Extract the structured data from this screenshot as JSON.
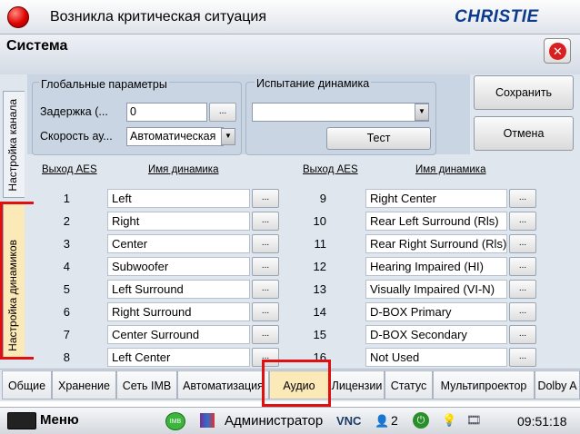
{
  "window": {
    "title": "Возникла критическая ситуация",
    "logo": "CHRISTIE"
  },
  "section": {
    "title": "Система",
    "close_icon": "close-icon"
  },
  "side_tabs": [
    "Настройка канала",
    "Настройка динамиков"
  ],
  "global_params": {
    "label": "Глобальные параметры",
    "delay_label": "Задержка (...",
    "delay_value": "0",
    "speed_label": "Скорость ау...",
    "speed_value": "Автоматическая",
    "more": "..."
  },
  "speaker_test": {
    "label": "Испытание динамика",
    "select_value": "",
    "test_button": "Тест"
  },
  "actions": {
    "save": "Сохранить",
    "cancel": "Отмена"
  },
  "table": {
    "headers": {
      "aes": "Выход AES",
      "name": "Имя динамика"
    },
    "left": [
      {
        "n": "1",
        "name": "Left"
      },
      {
        "n": "2",
        "name": "Right"
      },
      {
        "n": "3",
        "name": "Center"
      },
      {
        "n": "4",
        "name": "Subwoofer"
      },
      {
        "n": "5",
        "name": "Left Surround"
      },
      {
        "n": "6",
        "name": "Right Surround"
      },
      {
        "n": "7",
        "name": "Center Surround"
      },
      {
        "n": "8",
        "name": "Left Center"
      }
    ],
    "right": [
      {
        "n": "9",
        "name": "Right Center"
      },
      {
        "n": "10",
        "name": "Rear Left Surround (Rls)"
      },
      {
        "n": "11",
        "name": "Rear Right Surround (Rls)"
      },
      {
        "n": "12",
        "name": "Hearing Impaired (HI)"
      },
      {
        "n": "13",
        "name": "Visually Impaired (VI-N)"
      },
      {
        "n": "14",
        "name": "D-BOX Primary"
      },
      {
        "n": "15",
        "name": "D-BOX Secondary"
      },
      {
        "n": "16",
        "name": "Not Used"
      }
    ]
  },
  "bottom_tabs": [
    "Общие",
    "Хранение",
    "Сеть IMB",
    "Автоматизация",
    "Аудио",
    "Лицензии",
    "Статус",
    "Мультипроектор",
    "Dolby A"
  ],
  "active_tab": "Аудио",
  "taskbar": {
    "menu": "Меню",
    "imb": "IMB",
    "user": "Администратор",
    "vnc": "VNC",
    "count": "2",
    "time": "09:51:18"
  },
  "colors": {
    "active_tab": "#fce9b8",
    "highlight": "#e01010",
    "logo": "#0d3a8c"
  }
}
